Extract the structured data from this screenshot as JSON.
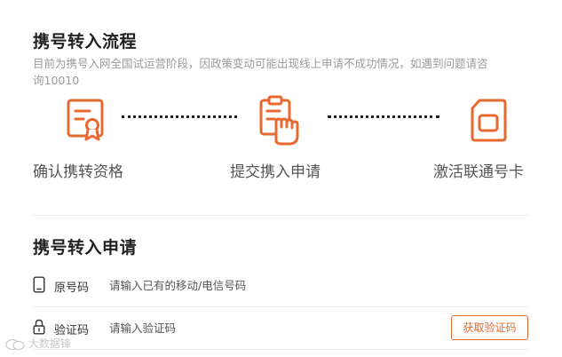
{
  "process": {
    "title": "携号转入流程",
    "notice": "目前为携号入网全国试运营阶段，因政策变动可能出现线上申请不成功情况，如遇到问题请咨询10010",
    "steps": [
      {
        "label": "确认携转资格",
        "icon": "certificate-icon"
      },
      {
        "label": "提交携入申请",
        "icon": "clipboard-hand-icon"
      },
      {
        "label": "激活联通号卡",
        "icon": "sim-card-icon"
      }
    ]
  },
  "application": {
    "title": "携号转入申请",
    "original_number": {
      "label": "原号码",
      "placeholder": "请输入已有的移动/电信号码",
      "icon": "phone-icon"
    },
    "verification_code": {
      "label": "验证码",
      "placeholder": "请输入验证码",
      "icon": "lock-icon",
      "button_label": "获取验证码"
    }
  },
  "watermark": {
    "text": "大数据锋",
    "icon": "wechat-logo-icon"
  },
  "colors": {
    "accent": "#e8692f",
    "title": "#222222",
    "muted": "#9a9a9a"
  }
}
